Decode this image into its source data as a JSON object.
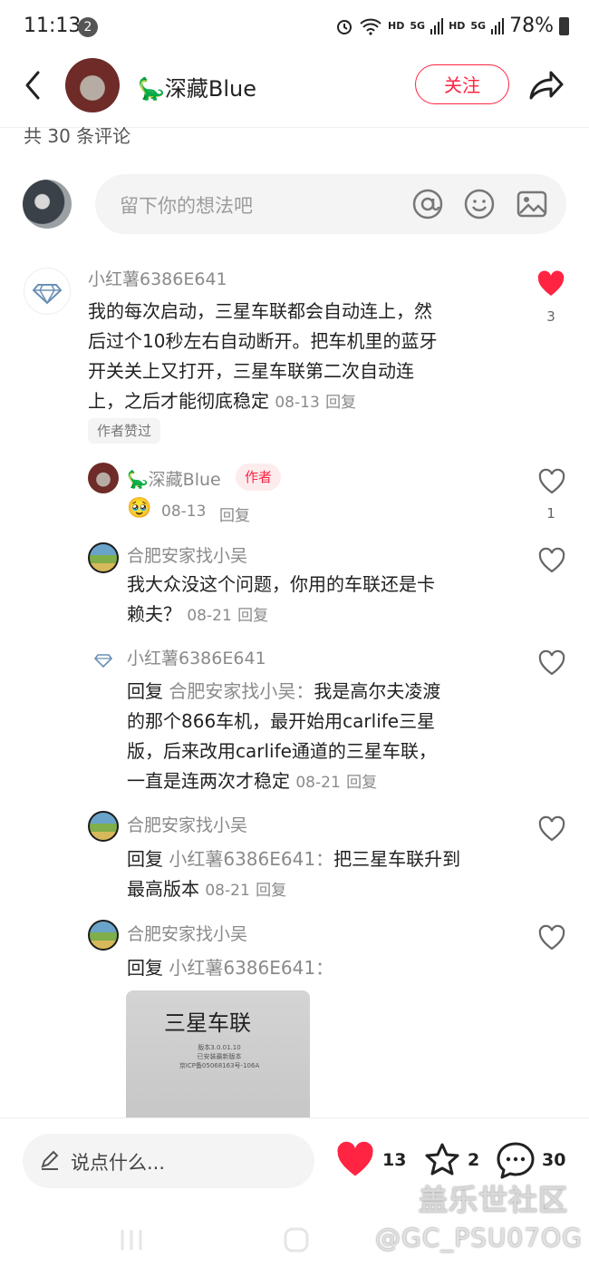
{
  "status": {
    "time": "11:13",
    "badge": "2",
    "hd1": "HD",
    "g1": "5G",
    "hd2": "HD",
    "g2": "5G",
    "battery": "78%"
  },
  "header": {
    "title": "🦕深藏Blue",
    "follow": "关注"
  },
  "comment_count": "共 30 条评论",
  "input": {
    "placeholder": "留下你的想法吧"
  },
  "comments": [
    {
      "name": "小红薯6386E641",
      "lines": [
        "我的每次启动，三星车联都会自动连上，然",
        "后过个10秒左右自动断开。把车机里的蓝牙",
        "开关关上又打开，三星车联第二次自动连"
      ],
      "last": "上，之后才能彻底稳定",
      "date": "08-13",
      "reply": "回复",
      "tag": "作者赞过",
      "likes": "3"
    },
    {
      "name": "🦕深藏Blue",
      "author_tag": "作者",
      "emoji": "🥹",
      "date": "08-13",
      "reply": "回复",
      "likes": "1"
    },
    {
      "name": "合肥安家找小吴",
      "lines": [
        "我大众没这个问题，你用的车联还是卡"
      ],
      "last": "赖夫？",
      "date": "08-21",
      "reply": "回复"
    },
    {
      "name": "小红薯6386E641",
      "reply_prefix": "回复",
      "reply_to": "合肥安家找小吴：",
      "first": "我是高尔夫凌渡",
      "lines": [
        "的那个866车机，最开始用carlife三星",
        "版，后来改用carlife通道的三星车联，"
      ],
      "last": "一直是连两次才稳定",
      "date": "08-21",
      "reply": "回复"
    },
    {
      "name": "合肥安家找小吴",
      "reply_prefix": "回复",
      "reply_to": "小红薯6386E641：",
      "first": "把三星车联升到",
      "last": "最高版本",
      "date": "08-21",
      "reply": "回复"
    },
    {
      "name": "合肥安家找小吴",
      "reply_prefix": "回复",
      "reply_to": "小红薯6386E641：",
      "photo_title": "三星车联",
      "photo_lines": [
        "版本3.0.01.10",
        "已安装最新版本",
        "京ICP备05068163号-106A"
      ]
    }
  ],
  "bottom": {
    "placeholder": "说点什么...",
    "likes": "13",
    "stars": "2",
    "comments": "30"
  },
  "watermark": {
    "line1": "盖乐世社区",
    "line2": "@GC_PSU07OG"
  },
  "colors": {
    "accent": "#ff2442"
  }
}
